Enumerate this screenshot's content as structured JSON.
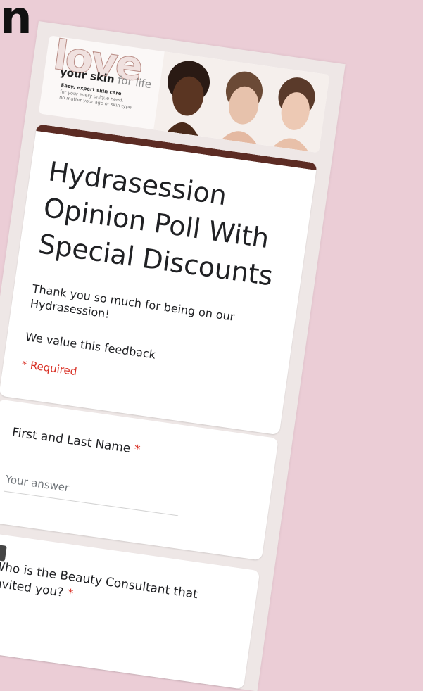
{
  "corner_glyph": "n",
  "banner": {
    "logo_word": "love",
    "tagline_bold": "your skin",
    "tagline_light": "for life",
    "subline1": "Easy, expert skin care",
    "subline2": "for your every unique need,",
    "subline3": "no matter your age or skin type"
  },
  "form": {
    "title": "Hydrasession Opinion Poll With Special Discounts",
    "description": "Thank you so much for being on our Hydrasession!",
    "feedback_note": "We value this feedback",
    "required_note": "* Required"
  },
  "questions": [
    {
      "label": "First and Last Name",
      "required_marker": "*",
      "placeholder": "Your answer"
    },
    {
      "label": "Who is the Beauty Consultant that invited you?",
      "required_marker": "*"
    }
  ],
  "feedback_badge": "!",
  "colors": {
    "background": "#ebcdd6",
    "accent_bar": "#5c2c24",
    "required": "#d93025"
  }
}
